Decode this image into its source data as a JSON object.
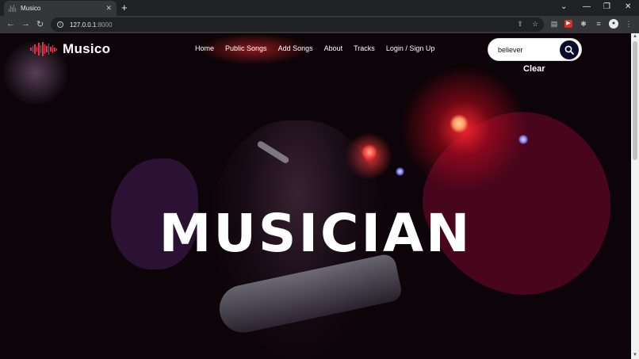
{
  "browser": {
    "tab_title": "Musico",
    "tab_close": "✕",
    "new_tab": "+",
    "url_host": "127.0.0.1",
    "url_port": ":8000",
    "window_controls": [
      "⌄",
      "—",
      "❐",
      "✕"
    ]
  },
  "site": {
    "logo_text": "Musico",
    "nav": [
      "Home",
      "Public Songs",
      "Add Songs",
      "About",
      "Tracks",
      "Login / Sign Up"
    ],
    "search": {
      "value": "believer"
    },
    "clear_label": "Clear",
    "hero_title": "MUSICIAN"
  },
  "colors": {
    "accent": "#e0344a",
    "search_button": "#0b0b2a",
    "glow_red": "#ff2832"
  },
  "icons": [
    "back-icon",
    "forward-icon",
    "reload-icon",
    "info-icon",
    "share-icon",
    "star-icon",
    "extension-icon",
    "puzzle-icon",
    "menu-icon",
    "search-icon",
    "soundwave-logo-icon"
  ]
}
